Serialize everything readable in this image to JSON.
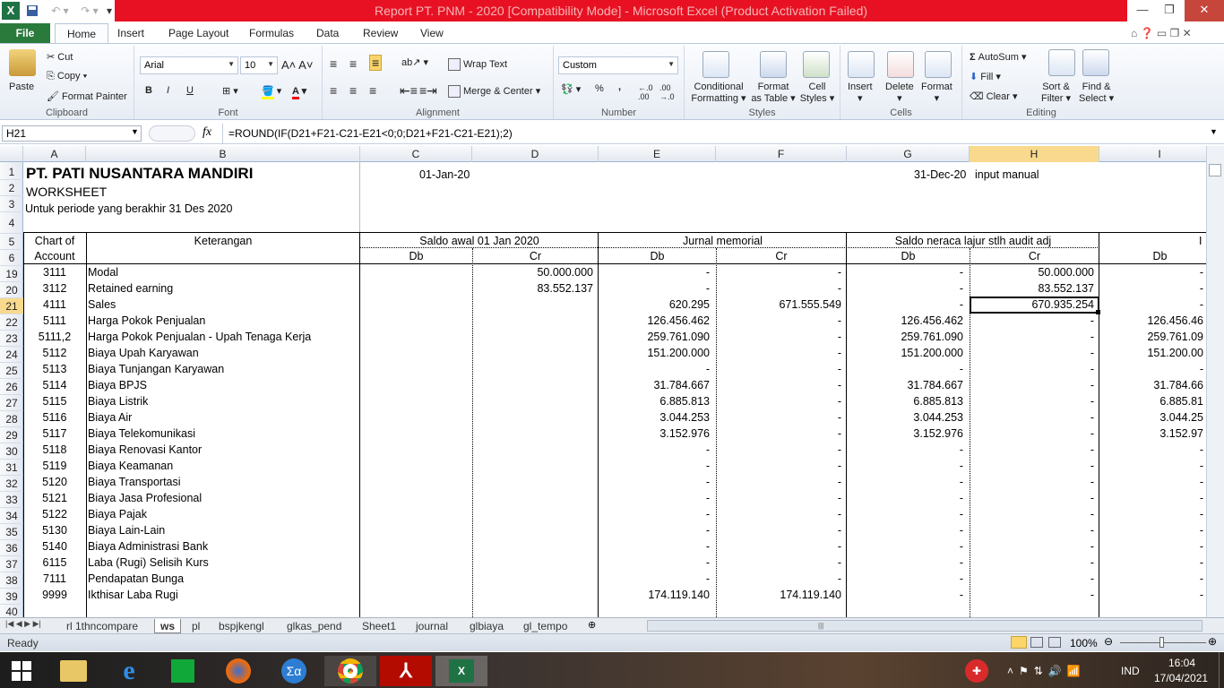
{
  "window": {
    "title": "Report PT. PNM - 2020  [Compatibility Mode]  -  Microsoft Excel (Product Activation Failed)"
  },
  "ribbon_tabs": [
    "File",
    "Home",
    "Insert",
    "Page Layout",
    "Formulas",
    "Data",
    "Review",
    "View"
  ],
  "ribbon": {
    "clipboard": {
      "paste": "Paste",
      "cut": "Cut",
      "copy": "Copy",
      "format_painter": "Format Painter",
      "label": "Clipboard"
    },
    "font": {
      "name": "Arial",
      "size": "10",
      "label": "Font",
      "bold": "B",
      "italic": "I",
      "underline": "U"
    },
    "alignment": {
      "wrap": "Wrap Text",
      "merge": "Merge & Center",
      "label": "Alignment"
    },
    "number": {
      "format": "Custom",
      "label": "Number",
      "percent": "%",
      "comma": ","
    },
    "styles": {
      "conditional": "Conditional",
      "conditional2": "Formatting",
      "format_table": "Format",
      "format_table2": "as Table",
      "cell_styles": "Cell",
      "cell_styles2": "Styles",
      "label": "Styles"
    },
    "cells": {
      "insert": "Insert",
      "delete": "Delete",
      "format": "Format",
      "label": "Cells"
    },
    "editing": {
      "autosum": "AutoSum",
      "fill": "Fill",
      "clear": "Clear",
      "sort": "Sort &",
      "sort2": "Filter",
      "find": "Find &",
      "find2": "Select",
      "label": "Editing"
    }
  },
  "formula_bar": {
    "name_box": "H21",
    "fx": "fx",
    "formula": "=ROUND(IF(D21+F21-C21-E21<0;0;D21+F21-C21-E21);2)"
  },
  "columns": [
    "A",
    "B",
    "C",
    "D",
    "E",
    "F",
    "G",
    "H",
    "I"
  ],
  "row_numbers": [
    "1",
    "2",
    "3",
    "4",
    "5",
    "6",
    "19",
    "20",
    "21",
    "22",
    "23",
    "24",
    "25",
    "26",
    "27",
    "28",
    "29",
    "30",
    "31",
    "32",
    "33",
    "34",
    "35",
    "36",
    "37",
    "38",
    "39",
    "40"
  ],
  "header": {
    "company": "PT. PATI NUSANTARA MANDIRI",
    "subtitle": "WORKSHEET",
    "period": "Untuk periode yang berakhir 31 Des 2020",
    "date_start": "01-Jan-20",
    "date_end": "31-Dec-20",
    "note": "input manual",
    "coa1": "Chart of",
    "coa2": "Account",
    "keterangan": "Keterangan",
    "saldo_awal": "Saldo awal 01 Jan 2020",
    "jurnal": "Jurnal memorial",
    "saldo_neraca": "Saldo neraca lajur stlh audit adj",
    "db": "Db",
    "cr": "Cr",
    "i_trunc": "I"
  },
  "rows": [
    {
      "coa": "3111",
      "desc": "Modal",
      "c": "",
      "d": "50.000.000",
      "e": "-",
      "f": "-",
      "g": "-",
      "h": "50.000.000",
      "i": "-"
    },
    {
      "coa": "3112",
      "desc": "Retained earning",
      "c": "",
      "d": "83.552.137",
      "e": "-",
      "f": "-",
      "g": "-",
      "h": "83.552.137",
      "i": "-"
    },
    {
      "coa": "4111",
      "desc": "Sales",
      "c": "",
      "d": "",
      "e": "620.295",
      "f": "671.555.549",
      "g": "-",
      "h": "670.935.254",
      "i": "-"
    },
    {
      "coa": "5111",
      "desc": "Harga Pokok Penjualan",
      "c": "",
      "d": "",
      "e": "126.456.462",
      "f": "-",
      "g": "126.456.462",
      "h": "-",
      "i": "126.456.46"
    },
    {
      "coa": "5111,2",
      "desc": "Harga Pokok Penjualan - Upah Tenaga Kerja",
      "c": "",
      "d": "",
      "e": "259.761.090",
      "f": "-",
      "g": "259.761.090",
      "h": "-",
      "i": "259.761.09"
    },
    {
      "coa": "5112",
      "desc": "Biaya Upah Karyawan",
      "c": "",
      "d": "",
      "e": "151.200.000",
      "f": "-",
      "g": "151.200.000",
      "h": "-",
      "i": "151.200.00"
    },
    {
      "coa": "5113",
      "desc": "Biaya Tunjangan Karyawan",
      "c": "",
      "d": "",
      "e": "-",
      "f": "-",
      "g": "-",
      "h": "-",
      "i": "-"
    },
    {
      "coa": "5114",
      "desc": "Biaya BPJS",
      "c": "",
      "d": "",
      "e": "31.784.667",
      "f": "-",
      "g": "31.784.667",
      "h": "-",
      "i": "31.784.66"
    },
    {
      "coa": "5115",
      "desc": "Biaya Listrik",
      "c": "",
      "d": "",
      "e": "6.885.813",
      "f": "-",
      "g": "6.885.813",
      "h": "-",
      "i": "6.885.81"
    },
    {
      "coa": "5116",
      "desc": "Biaya Air",
      "c": "",
      "d": "",
      "e": "3.044.253",
      "f": "-",
      "g": "3.044.253",
      "h": "-",
      "i": "3.044.25"
    },
    {
      "coa": "5117",
      "desc": "Biaya Telekomunikasi",
      "c": "",
      "d": "",
      "e": "3.152.976",
      "f": "-",
      "g": "3.152.976",
      "h": "-",
      "i": "3.152.97"
    },
    {
      "coa": "5118",
      "desc": "Biaya Renovasi Kantor",
      "c": "",
      "d": "",
      "e": "-",
      "f": "-",
      "g": "-",
      "h": "-",
      "i": "-"
    },
    {
      "coa": "5119",
      "desc": "Biaya Keamanan",
      "c": "",
      "d": "",
      "e": "-",
      "f": "-",
      "g": "-",
      "h": "-",
      "i": "-"
    },
    {
      "coa": "5120",
      "desc": "Biaya Transportasi",
      "c": "",
      "d": "",
      "e": "-",
      "f": "-",
      "g": "-",
      "h": "-",
      "i": "-"
    },
    {
      "coa": "5121",
      "desc": "Biaya Jasa Profesional",
      "c": "",
      "d": "",
      "e": "-",
      "f": "-",
      "g": "-",
      "h": "-",
      "i": "-"
    },
    {
      "coa": "5122",
      "desc": "Biaya Pajak",
      "c": "",
      "d": "",
      "e": "-",
      "f": "-",
      "g": "-",
      "h": "-",
      "i": "-"
    },
    {
      "coa": "5130",
      "desc": "Biaya Lain-Lain",
      "c": "",
      "d": "",
      "e": "-",
      "f": "-",
      "g": "-",
      "h": "-",
      "i": "-"
    },
    {
      "coa": "5140",
      "desc": "Biaya Administrasi Bank",
      "c": "",
      "d": "",
      "e": "-",
      "f": "-",
      "g": "-",
      "h": "-",
      "i": "-"
    },
    {
      "coa": "6115",
      "desc": "Laba (Rugi) Selisih Kurs",
      "c": "",
      "d": "",
      "e": "-",
      "f": "-",
      "g": "-",
      "h": "-",
      "i": "-"
    },
    {
      "coa": "7111",
      "desc": "Pendapatan Bunga",
      "c": "",
      "d": "",
      "e": "-",
      "f": "-",
      "g": "-",
      "h": "-",
      "i": "-"
    },
    {
      "coa": "9999",
      "desc": "Ikthisar Laba Rugi",
      "c": "",
      "d": "",
      "e": "174.119.140",
      "f": "174.119.140",
      "g": "-",
      "h": "-",
      "i": "-"
    }
  ],
  "sheet_tabs": [
    "rl 1thncompare",
    "ws",
    "pl",
    "bspjkengl",
    "glkas_pend",
    "Sheet1",
    "journal",
    "glbiaya",
    "gl_tempo"
  ],
  "active_sheet": "ws",
  "status": {
    "ready": "Ready",
    "zoom": "100%"
  },
  "taskbar": {
    "time": "16:04",
    "date": "17/04/2021",
    "lang": "IND"
  },
  "colors": {
    "excel_green": "#1f7244",
    "title_red": "#e81123",
    "selection": "#f8d98d"
  }
}
